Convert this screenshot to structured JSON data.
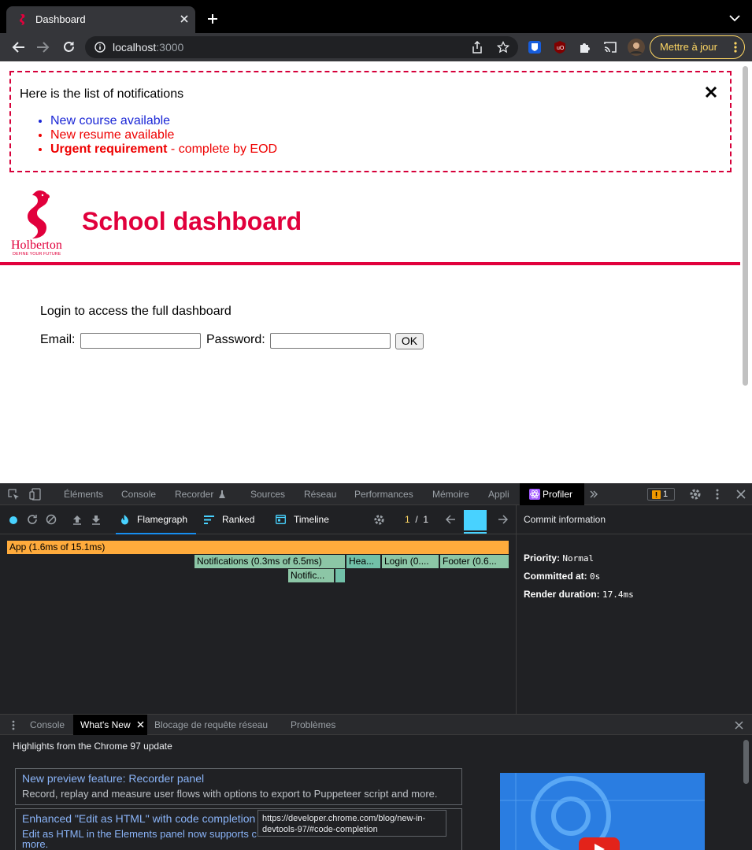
{
  "browser": {
    "tab_title": "Dashboard",
    "url_host": "localhost",
    "url_port": ":3000",
    "update_label": "Mettre à jour"
  },
  "page": {
    "notifications": {
      "title": "Here is the list of notifications",
      "items": [
        {
          "type": "default",
          "text": "New course available"
        },
        {
          "type": "urgent",
          "text": "New resume available"
        },
        {
          "type": "urgent",
          "bold": "Urgent requirement",
          "rest": " - complete by EOD"
        }
      ]
    },
    "logo": {
      "wordmark": "Holberton",
      "tagline": "DEFINE YOUR FUTURE"
    },
    "title": "School dashboard",
    "login": {
      "intro": "Login to access the full dashboard",
      "email_label": "Email:",
      "password_label": "Password:",
      "ok_label": "OK"
    },
    "colors": {
      "brand": "#e1003c",
      "default_notif": "#1a26d6",
      "urgent_notif": "#ee0000"
    }
  },
  "devtools": {
    "tabs": [
      "Éléments",
      "Console",
      "Recorder",
      "Sources",
      "Réseau",
      "Performances",
      "Mémoire",
      "Appli",
      "Profiler"
    ],
    "issues_count": "1",
    "profiler": {
      "tabs": {
        "flamegraph": "Flamegraph",
        "ranked": "Ranked",
        "timeline": "Timeline"
      },
      "commit_current": "1",
      "commit_sep": "/",
      "commit_total": "1",
      "flame": [
        {
          "label": "App (1.6ms of 15.1ms)"
        },
        {
          "label": "Notifications (0.3ms of 6.5ms)"
        },
        {
          "label": "Hea..."
        },
        {
          "label": "Login (0...."
        },
        {
          "label": "Footer (0.6..."
        },
        {
          "label": "Notific..."
        }
      ],
      "commit_info": {
        "heading": "Commit information",
        "priority_label": "Priority",
        "priority_value": "Normal",
        "committed_label": "Committed at",
        "committed_value": "0s",
        "render_label": "Render duration",
        "render_value": "17.4ms"
      }
    },
    "drawer": {
      "tabs": [
        "Console",
        "What's New",
        "Blocage de requête réseau",
        "Problèmes"
      ],
      "highlights": "Highlights from the Chrome 97 update",
      "cards": [
        {
          "title": "New preview feature: Recorder panel",
          "desc": "Record, replay and measure user flows with options to export to Puppeteer script and more."
        },
        {
          "title": "Enhanced \"Edit as HTML\" with code completion",
          "desc_start": "Edit as HTML in the Elements panel now supports c",
          "desc_end": "more."
        }
      ],
      "tooltip": "https://developer.chrome.com/blog/new-in-devtools-97/#code-completion"
    }
  }
}
